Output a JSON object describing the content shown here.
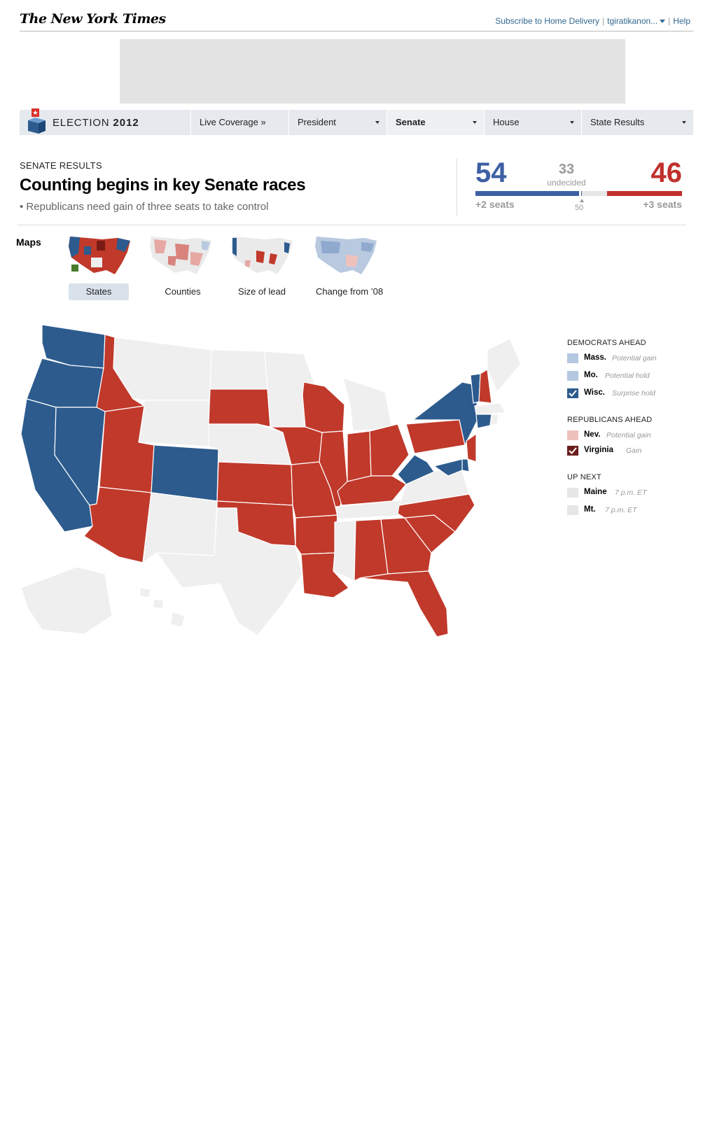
{
  "masthead": {
    "logo": "The New York Times",
    "subscribe": "Subscribe to Home Delivery",
    "user": "tgiratikanon...",
    "help": "Help"
  },
  "nav": {
    "brand_prefix": "ELECTION",
    "brand_year": "2012",
    "tabs": [
      {
        "label": "Live Coverage »"
      },
      {
        "label": "President"
      },
      {
        "label": "Senate"
      },
      {
        "label": "House"
      },
      {
        "label": "State Results"
      }
    ],
    "active": "Senate"
  },
  "header": {
    "kicker": "SENATE RESULTS",
    "headline": "Counting begins in key Senate races",
    "subhead": "Republicans need gain of three seats to take control"
  },
  "scoreboard": {
    "dem_seats": "54",
    "rep_seats": "46",
    "undecided_count": "33",
    "undecided_label": "undecided",
    "dem_gain": "+2 seats",
    "rep_gain": "+3 seats",
    "majority_mark": "50",
    "colors": {
      "dem": "#3d5fa3",
      "rep": "#c0302c",
      "undecided": "#e6e6e6"
    }
  },
  "maps": {
    "label": "Maps",
    "options": [
      "States",
      "Counties",
      "Size of lead",
      "Change from ’08"
    ],
    "selected": "States"
  },
  "map": {
    "colors": {
      "dem": "#2d5b8e",
      "rep": "#c0392b",
      "none": "#efefef",
      "border": "#ffffff"
    },
    "dem_states": [
      "WA",
      "OR",
      "CA",
      "NV",
      "CO",
      "NY",
      "VT",
      "CT",
      "WV",
      "MD",
      "DE"
    ],
    "rep_states": [
      "ID",
      "UT",
      "AZ",
      "SD",
      "KS",
      "OK",
      "IA",
      "MO",
      "AR",
      "LA",
      "WI",
      "IL",
      "IN",
      "OH",
      "KY",
      "PA",
      "NH",
      "NJ",
      "AL",
      "GA",
      "SC",
      "NC",
      "FL"
    ]
  },
  "legend": {
    "dem_heading": "DEMOCRATS AHEAD",
    "dem_items": [
      {
        "name": "Mass.",
        "note": "Potential gain"
      },
      {
        "name": "Mo.",
        "note": "Potential hold"
      },
      {
        "name": "Wisc.",
        "note": "Surprise hold"
      }
    ],
    "rep_heading": "REPUBLICANS AHEAD",
    "rep_items": [
      {
        "name": "Nev.",
        "note": "Potential gain"
      },
      {
        "name": "Virginia",
        "note": "Gain"
      }
    ],
    "next_heading": "UP NEXT",
    "next_items": [
      {
        "name": "Maine",
        "note": "7 p.m. ET"
      },
      {
        "name": "Mt.",
        "note": "7 p.m. ET"
      }
    ],
    "colors": {
      "dem_light": "#b3c7e0",
      "dem_check": "#2d5b8e",
      "rep_light": "#eec1bd",
      "rep_check": "#6b1d1d",
      "next": "#e6e6e6"
    }
  }
}
